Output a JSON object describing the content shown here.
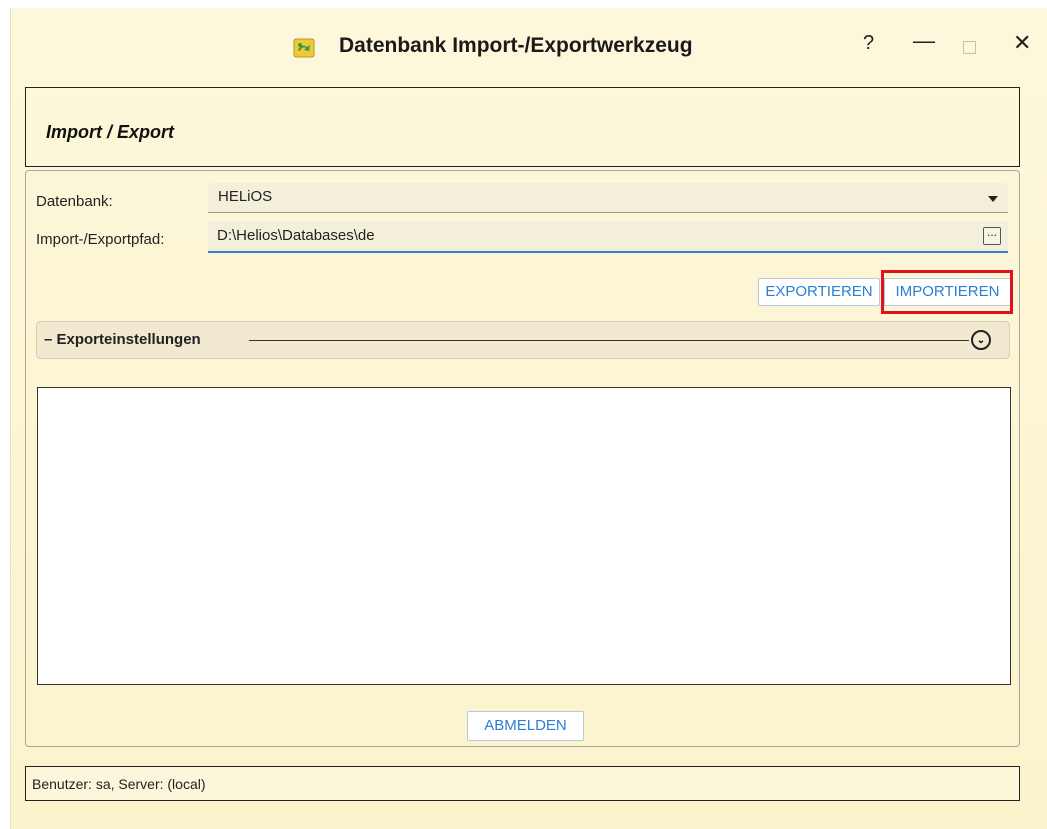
{
  "window": {
    "title": "Datenbank Import-/Exportwerkzeug",
    "help_label": "?",
    "minimize_label": "—",
    "close_label": "✕"
  },
  "header": {
    "title": "Import / Export"
  },
  "form": {
    "database_label": "Datenbank:",
    "database_value": "HELiOS",
    "path_label": "Import-/Exportpfad:",
    "path_value": "D:\\Helios\\Databases\\de",
    "browse_label": "..."
  },
  "actions": {
    "export_label": "EXPORTIEREN",
    "import_label": "IMPORTIEREN"
  },
  "settings": {
    "label": "– Exporteinstellungen",
    "expand_glyph": "⌄"
  },
  "logout": {
    "label": "ABMELDEN"
  },
  "status": {
    "text": "Benutzer: sa, Server: (local)"
  },
  "colors": {
    "highlight": "#e0121f",
    "accent": "#2b7fd4",
    "background": "#fcf5d2"
  }
}
